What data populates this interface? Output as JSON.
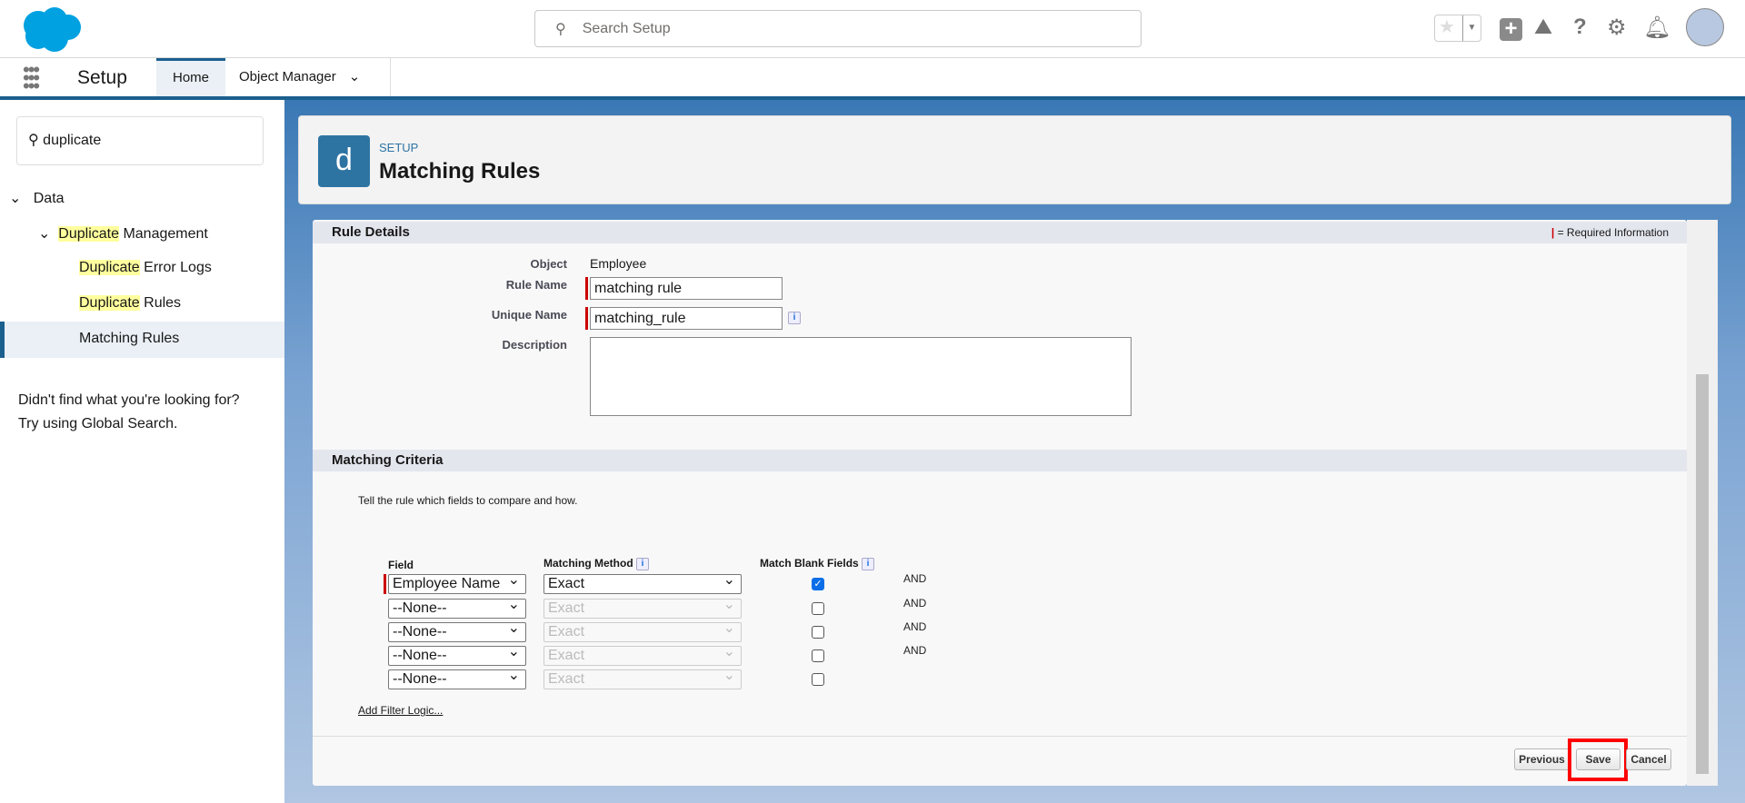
{
  "header": {
    "search_placeholder": "Search Setup",
    "icons": [
      "favorites-star-icon",
      "add-icon",
      "trailhead-icon",
      "help-icon",
      "gear-icon",
      "bell-icon",
      "avatar"
    ]
  },
  "tabbar": {
    "app_name": "Setup",
    "tabs": [
      {
        "label": "Home",
        "active": true
      },
      {
        "label": "Object Manager"
      }
    ]
  },
  "sidebar": {
    "search_value": "duplicate",
    "tree": {
      "data": "Data",
      "dup_mgmt_hl": "Duplicate",
      "dup_mgmt_rest": " Management",
      "items": [
        {
          "hl": "Duplicate",
          "rest": " Error Logs"
        },
        {
          "hl": "Duplicate",
          "rest": " Rules"
        },
        {
          "hl": "",
          "rest": "Matching Rules",
          "selected": true
        }
      ]
    },
    "not_found_1": "Didn't find what you're looking for?",
    "not_found_2": "Try using Global Search."
  },
  "page_header": {
    "icon_letter": "d",
    "breadcrumb": "SETUP",
    "title": "Matching Rules"
  },
  "rule_details": {
    "title": "Rule Details",
    "required_legend": "= Required Information",
    "object_label": "Object",
    "object_value": "Employee",
    "rule_name_label": "Rule Name",
    "rule_name_value": "matching rule",
    "unique_name_label": "Unique Name",
    "unique_name_value": "matching_rule",
    "description_label": "Description",
    "description_value": ""
  },
  "matching_criteria": {
    "title": "Matching Criteria",
    "instructions": "Tell the rule which fields to compare and how.",
    "columns": {
      "field": "Field",
      "method": "Matching Method",
      "blank": "Match Blank Fields"
    },
    "rows": [
      {
        "field": "Employee Name",
        "method": "Exact",
        "blank": true,
        "logic": "AND"
      },
      {
        "field": "--None--",
        "method": "Exact",
        "blank": false,
        "logic": "AND"
      },
      {
        "field": "--None--",
        "method": "Exact",
        "blank": false,
        "logic": "AND"
      },
      {
        "field": "--None--",
        "method": "Exact",
        "blank": false,
        "logic": "AND"
      },
      {
        "field": "--None--",
        "method": "Exact",
        "blank": false,
        "logic": ""
      }
    ],
    "add_filter_logic": "Add Filter Logic..."
  },
  "footer": {
    "previous": "Previous",
    "save": "Save",
    "cancel": "Cancel"
  },
  "colors": {
    "brand": "#00a1e0",
    "highlight": "#ff0000",
    "accent": "#1b5f8f"
  }
}
